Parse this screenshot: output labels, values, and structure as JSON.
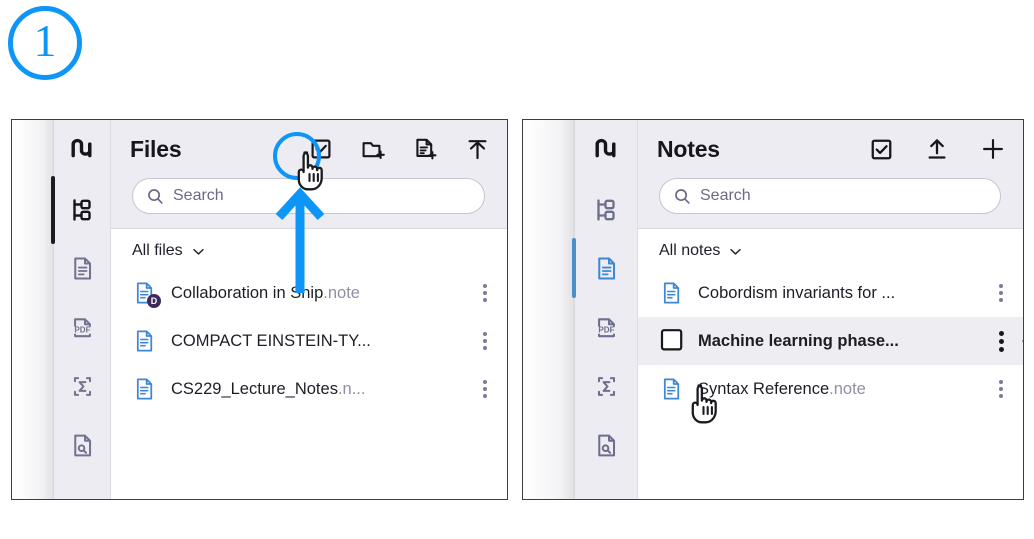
{
  "annotation": {
    "step_number": "1",
    "accent_color": "#0d96f8"
  },
  "panels": [
    {
      "id": "files",
      "header": {
        "title": "Files",
        "actions": [
          {
            "name": "select-mode-icon",
            "label": "Select",
            "highlighted": true
          },
          {
            "name": "new-folder-icon",
            "label": "New folder",
            "highlighted": false
          },
          {
            "name": "new-file-icon",
            "label": "New file",
            "highlighted": false
          },
          {
            "name": "upload-icon",
            "label": "Upload",
            "highlighted": false
          }
        ]
      },
      "search": {
        "placeholder": "Search",
        "value": ""
      },
      "group": {
        "label": "All files",
        "chevron": "chevron-down-icon"
      },
      "rail": [
        {
          "name": "app-logo",
          "icon": "snip-logo-icon",
          "active": false
        },
        {
          "name": "sidebar-item-workspace",
          "icon": "tree-hierarchy-icon",
          "active": true
        },
        {
          "name": "sidebar-item-notes",
          "icon": "document-icon",
          "active": false
        },
        {
          "name": "sidebar-item-pdf",
          "icon": "pdf-icon",
          "active": false
        },
        {
          "name": "sidebar-item-formula",
          "icon": "sigma-formula-icon",
          "active": false
        },
        {
          "name": "sidebar-item-scan",
          "icon": "document-search-icon",
          "active": false
        }
      ],
      "rows": [
        {
          "icon": "document-icon",
          "badge": "D",
          "name": "Collaboration in Snip",
          "ext": ".note",
          "selected": false,
          "checkbox": false
        },
        {
          "icon": "document-icon",
          "badge": "",
          "name": "COMPACT EINSTEIN-TY...",
          "ext": "",
          "selected": false,
          "checkbox": false
        },
        {
          "icon": "document-icon",
          "badge": "",
          "name": "CS229_Lecture_Notes",
          "ext": ".n...",
          "selected": false,
          "checkbox": false
        }
      ]
    },
    {
      "id": "notes",
      "header": {
        "title": "Notes",
        "actions": [
          {
            "name": "select-mode-icon",
            "label": "Select",
            "highlighted": false
          },
          {
            "name": "upload-icon",
            "label": "Upload",
            "highlighted": false
          },
          {
            "name": "add-note-icon",
            "label": "New note",
            "highlighted": false
          }
        ]
      },
      "search": {
        "placeholder": "Search",
        "value": ""
      },
      "group": {
        "label": "All notes",
        "chevron": "chevron-down-icon"
      },
      "rail": [
        {
          "name": "app-logo",
          "icon": "snip-logo-icon",
          "active": false
        },
        {
          "name": "sidebar-item-workspace",
          "icon": "tree-hierarchy-icon",
          "active": false
        },
        {
          "name": "sidebar-item-notes",
          "icon": "document-icon",
          "active": true
        },
        {
          "name": "sidebar-item-pdf",
          "icon": "pdf-icon",
          "active": false
        },
        {
          "name": "sidebar-item-formula",
          "icon": "sigma-formula-icon",
          "active": false
        },
        {
          "name": "sidebar-item-scan",
          "icon": "document-search-icon",
          "active": false
        }
      ],
      "rows": [
        {
          "icon": "document-icon",
          "badge": "",
          "name": "Cobordism invariants for ...",
          "ext": "",
          "selected": false,
          "checkbox": false
        },
        {
          "icon": "checkbox-unchecked-icon",
          "badge": "",
          "name": "Machine learning phase...",
          "ext": "",
          "selected": true,
          "checkbox": true
        },
        {
          "icon": "document-icon",
          "badge": "",
          "name": "Syntax Reference",
          "ext": ".note",
          "selected": false,
          "checkbox": false
        }
      ]
    }
  ]
}
